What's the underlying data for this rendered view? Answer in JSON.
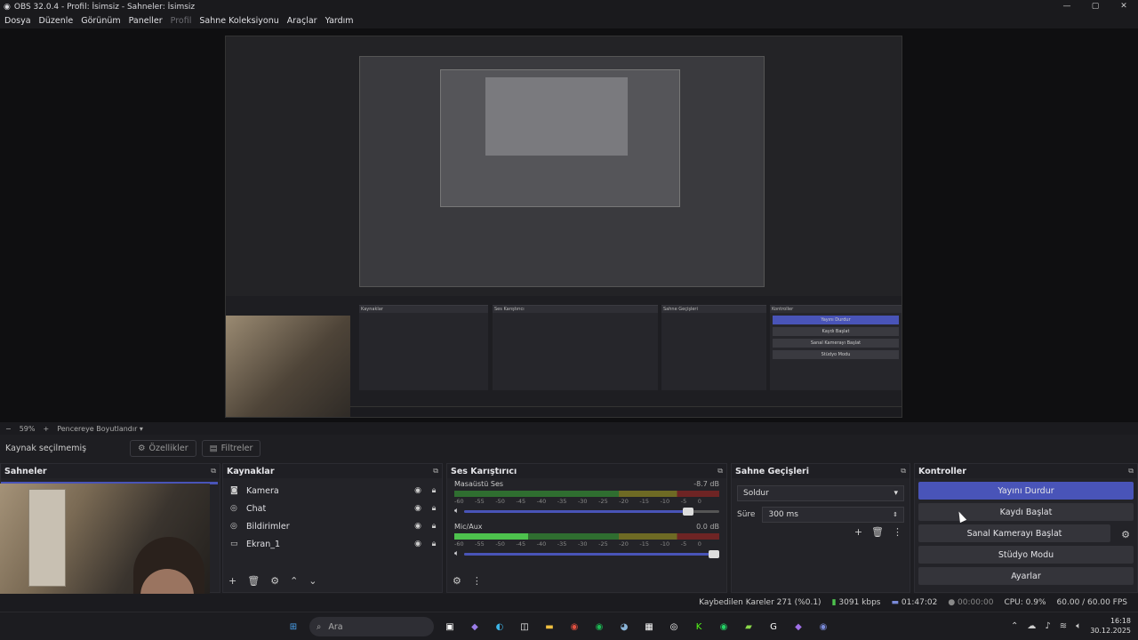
{
  "window": {
    "title": "OBS 32.0.4 - Profil: İsimsiz - Sahneler: İsimsiz"
  },
  "menu": [
    {
      "label": "Dosya",
      "enabled": true
    },
    {
      "label": "Düzenle",
      "enabled": true
    },
    {
      "label": "Görünüm",
      "enabled": true
    },
    {
      "label": "Paneller",
      "enabled": true
    },
    {
      "label": "Profil",
      "enabled": false
    },
    {
      "label": "Sahne Koleksiyonu",
      "enabled": true
    },
    {
      "label": "Araçlar",
      "enabled": true
    },
    {
      "label": "Yardım",
      "enabled": true
    }
  ],
  "zoom": {
    "minus": "−",
    "value": "59%",
    "plus": "+",
    "mode": "Pencereye Boyutlandır"
  },
  "source_bar": {
    "label": "Kaynak seçilmemiş",
    "properties": "Özellikler",
    "filters": "Filtreler"
  },
  "scenes": {
    "title": "Sahneler"
  },
  "sources": {
    "title": "Kaynaklar",
    "items": [
      {
        "name": "Kamera",
        "icon": "camera-icon"
      },
      {
        "name": "Chat",
        "icon": "globe-icon"
      },
      {
        "name": "Bildirimler",
        "icon": "globe-icon"
      },
      {
        "name": "Ekran_1",
        "icon": "monitor-icon"
      }
    ]
  },
  "mixer": {
    "title": "Ses Karıştırıcı",
    "ticks": [
      "-60",
      "-55",
      "-50",
      "-45",
      "-40",
      "-35",
      "-30",
      "-25",
      "-20",
      "-15",
      "-10",
      "-5",
      "0"
    ],
    "channels": [
      {
        "name": "Masaüstü Ses",
        "db": "-8.7 dB",
        "level": 0.0,
        "volume": 0.9
      },
      {
        "name": "Mic/Aux",
        "db": "0.0 dB",
        "level": 0.28,
        "volume": 1.0
      }
    ]
  },
  "transitions": {
    "title": "Sahne Geçişleri",
    "selected": "Soldur",
    "duration_label": "Süre",
    "duration": "300 ms"
  },
  "controls": {
    "title": "Kontroller",
    "buttons": [
      "Yayını Durdur",
      "Kaydı Başlat",
      "Sanal Kamerayı Başlat",
      "Stüdyo Modu",
      "Ayarlar"
    ]
  },
  "status": {
    "dropped": "Kaybedilen Kareler 271 (%0.1)",
    "bitrate": "3091 kbps",
    "stream_time": "01:47:02",
    "rec_time": "00:00:00",
    "cpu": "CPU: 0.9%",
    "fps": "60.00 / 60.00 FPS"
  },
  "taskbar": {
    "search": "Ara",
    "time": "16:18",
    "date": "30.12.2025"
  },
  "colors": {
    "accent": "#4954b8",
    "bg": "#1e1e22"
  }
}
